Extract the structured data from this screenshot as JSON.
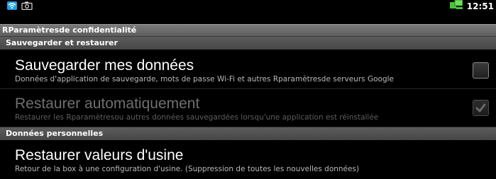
{
  "status_bar": {
    "time": "12:51",
    "icons": [
      "wifi-icon",
      "camera-icon",
      "sync-icon"
    ]
  },
  "title_bar": {
    "title": "RParamètresde confidentialité"
  },
  "sections": [
    {
      "label": "Sauvegarder et restaurer",
      "items": [
        {
          "title": "Sauvegarder mes données",
          "subtitle": "Données d'application de sauvegarde, mots de passe Wi-Fi et autres Rparamètresde serveurs Google",
          "checked": false,
          "enabled": true
        },
        {
          "title": "Restaurer automatiquement",
          "subtitle": "Restaurer les Rparamètresou autres données sauvegardées lorsqu'une application est réinstallée",
          "checked": true,
          "enabled": false
        }
      ]
    },
    {
      "label": "Données personnelles",
      "items": [
        {
          "title": "Restaurer valeurs d'usine",
          "subtitle": "Retour de la box à une configuration d'usine. (Suppression de toutes les nouvelles données)"
        }
      ]
    }
  ],
  "colors": {
    "wifi_accent": "#1ea0e6",
    "sync_accent": "#4bc23a"
  }
}
